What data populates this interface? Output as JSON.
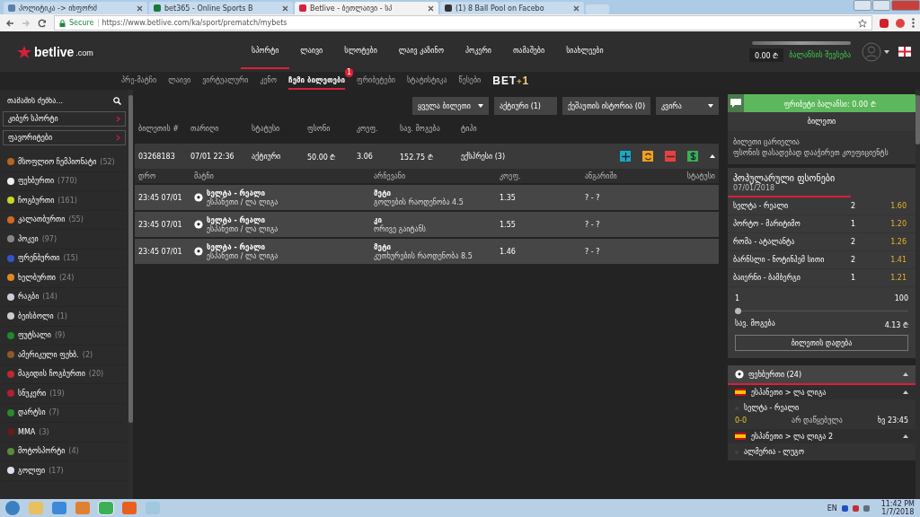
{
  "browser": {
    "tabs": [
      {
        "title": "პოლიტიკა -> ინფორმ",
        "selected": false
      },
      {
        "title": "bet365 - Online Sports B",
        "selected": false
      },
      {
        "title": "Betlive - ბეთლაივი - სპ",
        "selected": true
      },
      {
        "title": "(1) 8 Ball Pool on Facebo",
        "selected": false
      }
    ],
    "secure_label": "Secure",
    "url": "https://www.betlive.com/ka/sport/prematch/mybets"
  },
  "header": {
    "logo": "betlive",
    "logo_suffix": ".com",
    "nav": [
      {
        "label": "სპორტი",
        "selected": true
      },
      {
        "label": "ლაივი",
        "selected": false
      },
      {
        "label": "სლოტები",
        "selected": false
      },
      {
        "label": "ლაივ კაზინო",
        "selected": false
      },
      {
        "label": "პოკერი",
        "selected": false
      },
      {
        "label": "თამაშები",
        "selected": false
      },
      {
        "label": "სიახლეები",
        "selected": false
      }
    ],
    "balance": "0.00 ₾",
    "deposit_link": "ბალანსის შევსება"
  },
  "subnav": [
    {
      "label": "პრე-მატჩი",
      "selected": false
    },
    {
      "label": "ლაივი",
      "selected": false
    },
    {
      "label": "ვირტუალური",
      "selected": false
    },
    {
      "label": "კენო",
      "selected": false
    },
    {
      "label": "ჩემი ბილეთები",
      "selected": true,
      "badge": "1"
    },
    {
      "label": "ფრიბეტები",
      "selected": false
    },
    {
      "label": "სტატისტიკა",
      "selected": false
    },
    {
      "label": "წესები",
      "selected": false
    }
  ],
  "bet_plus": {
    "main": "BET",
    "plus": "+",
    "one": "1"
  },
  "sidebar": {
    "search": {
      "placeholder": "თამაშის ძებნა..."
    },
    "buttons": [
      "კიბერ სპორტი",
      "ფავორიტები"
    ],
    "sports": [
      {
        "name": "მსოფლიო ჩემპიონატი",
        "count": "(52)"
      },
      {
        "name": "ფეხბურთი",
        "count": "(770)"
      },
      {
        "name": "ჩოგბურთი",
        "count": "(161)"
      },
      {
        "name": "კალათბურთი",
        "count": "(55)"
      },
      {
        "name": "ჰოკეი",
        "count": "(97)"
      },
      {
        "name": "ფრენბურთი",
        "count": "(15)"
      },
      {
        "name": "ხელბურთი",
        "count": "(24)"
      },
      {
        "name": "რაგბი",
        "count": "(14)"
      },
      {
        "name": "ბეისბოლი",
        "count": "(1)"
      },
      {
        "name": "ფუტსალი",
        "count": "(9)"
      },
      {
        "name": "ამერიკული ფეხბ.",
        "count": "(2)"
      },
      {
        "name": "მაგიდის ჩოგბურთი",
        "count": "(20)"
      },
      {
        "name": "სნუკერი",
        "count": "(19)"
      },
      {
        "name": "დარტსი",
        "count": "(7)"
      },
      {
        "name": "MMA",
        "count": "(3)"
      },
      {
        "name": "მოტოსპორტი",
        "count": "(4)"
      },
      {
        "name": "გოლფი",
        "count": "(17)"
      }
    ]
  },
  "filters": [
    {
      "label": "ყველა ბილეთი",
      "kind": "dropdown"
    },
    {
      "label": "აქტიური (1)",
      "kind": "button"
    },
    {
      "label": "ქეშაუთის ისტორია (0)",
      "kind": "button"
    },
    {
      "label": "კვირა",
      "kind": "dropdown"
    }
  ],
  "table": {
    "columns": [
      "ბილეთის #",
      "თარიღი",
      "სტატუსი",
      "ფსონი",
      "კოეფ.",
      "სავ. მოგება",
      "ტიპი"
    ],
    "rows": [
      {
        "cells": [
          "03268183",
          "07/01 22:36",
          "აქტიური",
          "50.00 ₾",
          "3.06",
          "152.75 ₾",
          "ექსპრესი (3)"
        ],
        "expanded": true,
        "actions": [
          {
            "kind": "add",
            "color": "#1aa7c4"
          },
          {
            "kind": "refresh",
            "color": "#f0a020"
          },
          {
            "kind": "remove",
            "color": "#e84040"
          },
          {
            "kind": "cashout",
            "color": "#3cb054"
          }
        ],
        "detail_columns": [
          "დრო",
          "მატჩი",
          "არჩევანი",
          "კოეფ.",
          "ანგარიში",
          "სტატუსი"
        ],
        "selections": [
          {
            "time": "23:45 07/01",
            "match": "სელტა - რეალი",
            "league": "ესპანეთი / ლა ლიგა",
            "pick": "მეტი",
            "market": "გოლების რაოდენობა 4.5",
            "odds": "1.35",
            "score": "? - ?"
          },
          {
            "time": "23:45 07/01",
            "match": "სელტა - რეალი",
            "league": "ესპანეთი / ლა ლიგა",
            "pick": "კი",
            "market": "ორივე გაიტანს",
            "odds": "1.55",
            "score": "? - ?"
          },
          {
            "time": "23:45 07/01",
            "match": "სელტა - რეალი",
            "league": "ესპანეთი / ლა ლიგა",
            "pick": "მეტი",
            "market": "კუთხურების რაოდენობა 8.5",
            "odds": "1.46",
            "score": "? - ?"
          }
        ]
      }
    ]
  },
  "betslip": {
    "freebet": "ფრიბეტი ბალანსი: 0.00 ₾",
    "title": "ბილეთი",
    "empty_title": "ბილეთი ცარიელია",
    "empty_hint": "ფსონის დასადებად დააჭირეთ კოეფიციენტს"
  },
  "popular": {
    "title": "პოპულარული ფსონები",
    "date": "07/01/2018",
    "rows": [
      {
        "match": "სელტა - რეალი",
        "pick": "2",
        "odds": "1.60"
      },
      {
        "match": "პორტო - მარიტიმო",
        "pick": "1",
        "odds": "1.20"
      },
      {
        "match": "რომა - ატალანტა",
        "pick": "2",
        "odds": "1.26"
      },
      {
        "match": "ბარნსლი - ნოტინჰემ სითი",
        "pick": "2",
        "odds": "1.41"
      },
      {
        "match": "ბაიერნი - ბამბერგი",
        "pick": "1",
        "odds": "1.21"
      }
    ],
    "slider_min": "1",
    "slider_max": "100",
    "level": 0.0,
    "win_label": "სავ. მოგება",
    "win_value": "4.13 ₾",
    "button": "ბილეთის დადება"
  },
  "live": {
    "sport": "ფეხბურთი (24)",
    "expanded": true,
    "leagues": [
      {
        "name": "ესპანეთი > ლა ლიგა",
        "expanded": true,
        "matches": [
          {
            "teams": "სელტა - რეალი",
            "score": "0-0",
            "status": "არ დაწყებულა",
            "time": "ხვ 23:45"
          }
        ]
      },
      {
        "name": "ესპანეთი > ლა ლიგა 2",
        "expanded": true,
        "matches": [
          {
            "teams": "ალმერია - ლუგო"
          }
        ]
      }
    ]
  },
  "taskbar": {
    "lang": "EN",
    "time": "11:42 PM",
    "date": "1/7/2018"
  }
}
